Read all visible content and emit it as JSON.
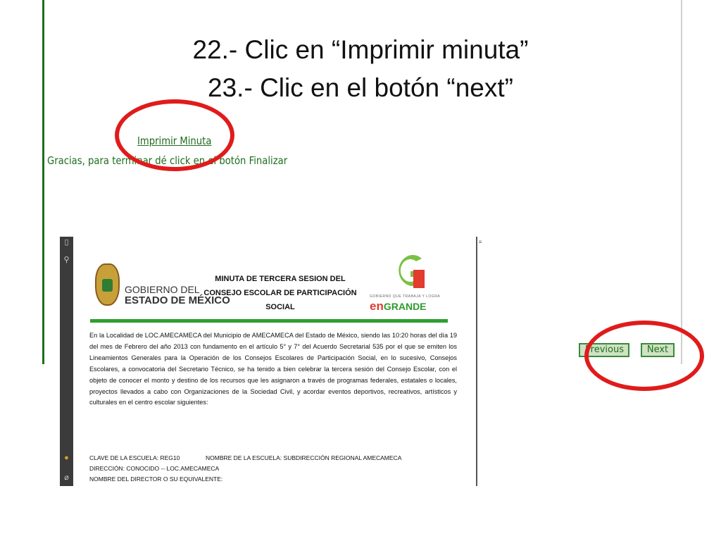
{
  "slide": {
    "title_line1": "22.- Clic en “Imprimir minuta”",
    "title_line2": "23.- Clic en el botón “next”"
  },
  "app": {
    "print_link": "Imprimir Minuta",
    "thanks_message": "Gracias, para terminar dé click en el botón Finalizar",
    "previous_button": "Previous",
    "next_button": "Next"
  },
  "document": {
    "government_line1": "GOBIERNO DEL",
    "government_line2": "ESTADO DE MÉXICO",
    "minuta_title": "MINUTA DE TERCERA SESION DEL CONSEJO ESCOLAR DE PARTICIPACIÓN SOCIAL",
    "logo_tagline": "GOBIERNO QUE TRABAJA Y LOGRA",
    "logo_en": "en",
    "logo_grande": "GRANDE",
    "body": "En la Localidad de LOC.AMECAMECA del Municipio de AMECAMECA del Estado de México, siendo las 10:20 horas del día 19 del mes de Febrero del año 2013 con fundamento en el artículo 5° y 7° del Acuerdo Secretarial 535 por el que se emiten los Lineamientos Generales para la Operación de los Consejos Escolares de Participación Social, en lo sucesivo, Consejos Escolares, a convocatoria del Secretario Técnico, se ha tenido a bien celebrar la tercera sesión del Consejo Escolar, con el objeto de conocer el monto y destino de los recursos que les asignaron a través de programas federales, estatales o locales, proyectos llevados a cabo con Organizaciones de la Sociedad Civil, y acordar eventos deportivos, recreativos, artísticos y culturales en el centro escolar siguientes:",
    "school_key": "CLAVE DE LA ESCUELA: REG10",
    "school_name": "NOMBRE DE LA ESCUELA: SUBDIRECCIÓN REGIONAL AMECAMECA",
    "address": "DIRECCIÓN:  CONOCIDO -- LOC.AMECAMECA",
    "director": "NOMBRE DEL DIRECTOR O SU EQUIVALENTE:"
  },
  "colors": {
    "accent_green": "#1f6d1f",
    "annotation_red": "#e01b1b"
  }
}
